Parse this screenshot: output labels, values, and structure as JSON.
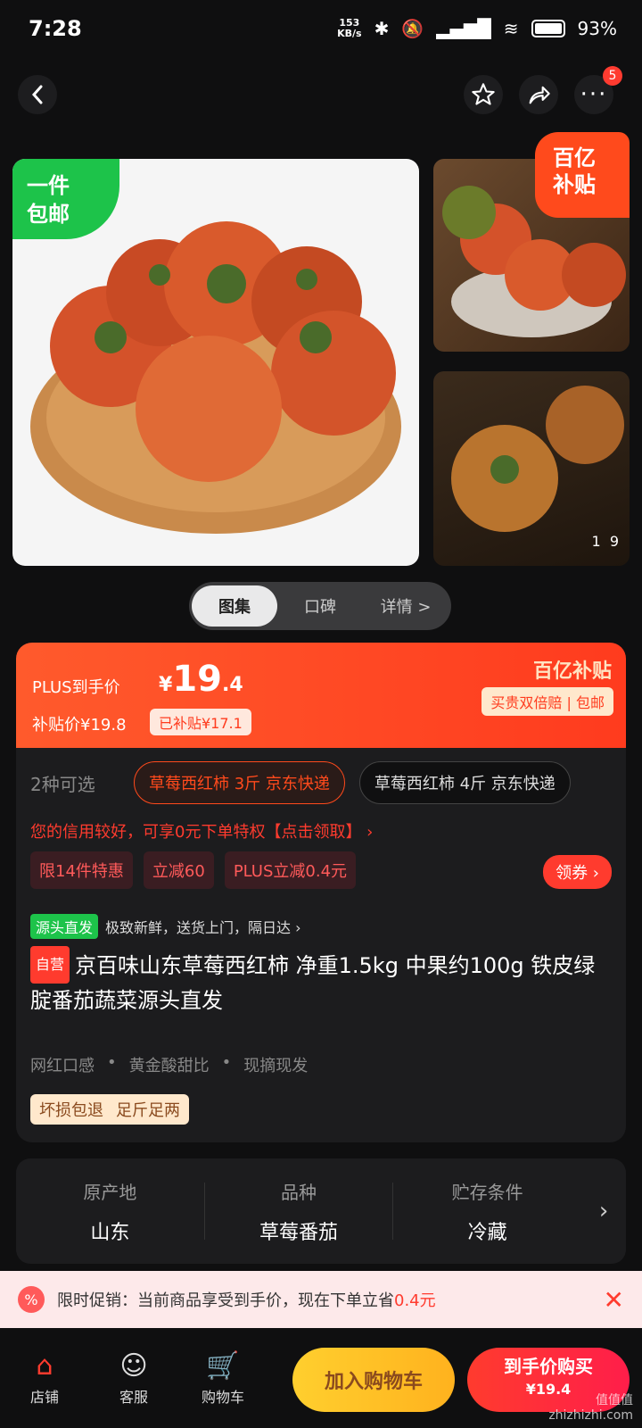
{
  "status": {
    "time": "7:28",
    "speed": "153\nKB/s",
    "battery": "93%"
  },
  "nav": {
    "badge": "5"
  },
  "gallery": {
    "tag_line1": "一件",
    "tag_line2": "包邮",
    "subsidy_line1": "百亿",
    "subsidy_line2": "补贴",
    "counter": "1  9"
  },
  "seg": [
    "图集",
    "口碑",
    "详情 >"
  ],
  "price": {
    "plus_label": "PLUS到手价",
    "currency": "¥",
    "main_int": "19",
    "main_dec": ".4",
    "subsidy_price": "补贴价¥19.8",
    "subsidy_tag": "已补贴¥17.1",
    "brand": "百亿补贴",
    "brand_sub": "买贵双倍赔 | 包邮"
  },
  "variants": {
    "count": "2种可选",
    "items": [
      "草莓西红柿 3斤 京东快递",
      "草莓西红柿 4斤 京东快递"
    ]
  },
  "credit": "您的信用较好，可享0元下单特权【点击领取】 ›",
  "promos": [
    "限14件特惠",
    "立减60",
    "PLUS立减0.4元"
  ],
  "coupon": "领券 ›",
  "source": {
    "tag": "源头直发",
    "text": "极致新鲜，送货上门，隔日达 ›"
  },
  "title": {
    "tag": "自营",
    "text": "京百味山东草莓西红柿 净重1.5kg 中果约100g 铁皮绿腚番茄蔬菜源头直发"
  },
  "features": [
    "网红口感",
    "•",
    "黄金酸甜比",
    "•",
    "现摘现发"
  ],
  "guarantee": [
    "坏损包退",
    "足斤足两"
  ],
  "attrs": [
    {
      "label": "原产地",
      "value": "山东"
    },
    {
      "label": "品种",
      "value": "草莓番茄"
    },
    {
      "label": "贮存条件",
      "value": "冷藏"
    }
  ],
  "banner": {
    "prefix": "限时促销：当前商品享受到手价，现在下单立省",
    "amount": "0.4元"
  },
  "bottombar": {
    "tabs": [
      {
        "label": "店铺",
        "icon": "store-icon"
      },
      {
        "label": "客服",
        "icon": "service-icon"
      },
      {
        "label": "购物车",
        "icon": "cart-icon"
      }
    ],
    "add_cart": "加入购物车",
    "buy_line1": "到手价购买",
    "buy_line2": "¥19.4"
  },
  "watermark": "值值值\nzhizhizhi.com"
}
